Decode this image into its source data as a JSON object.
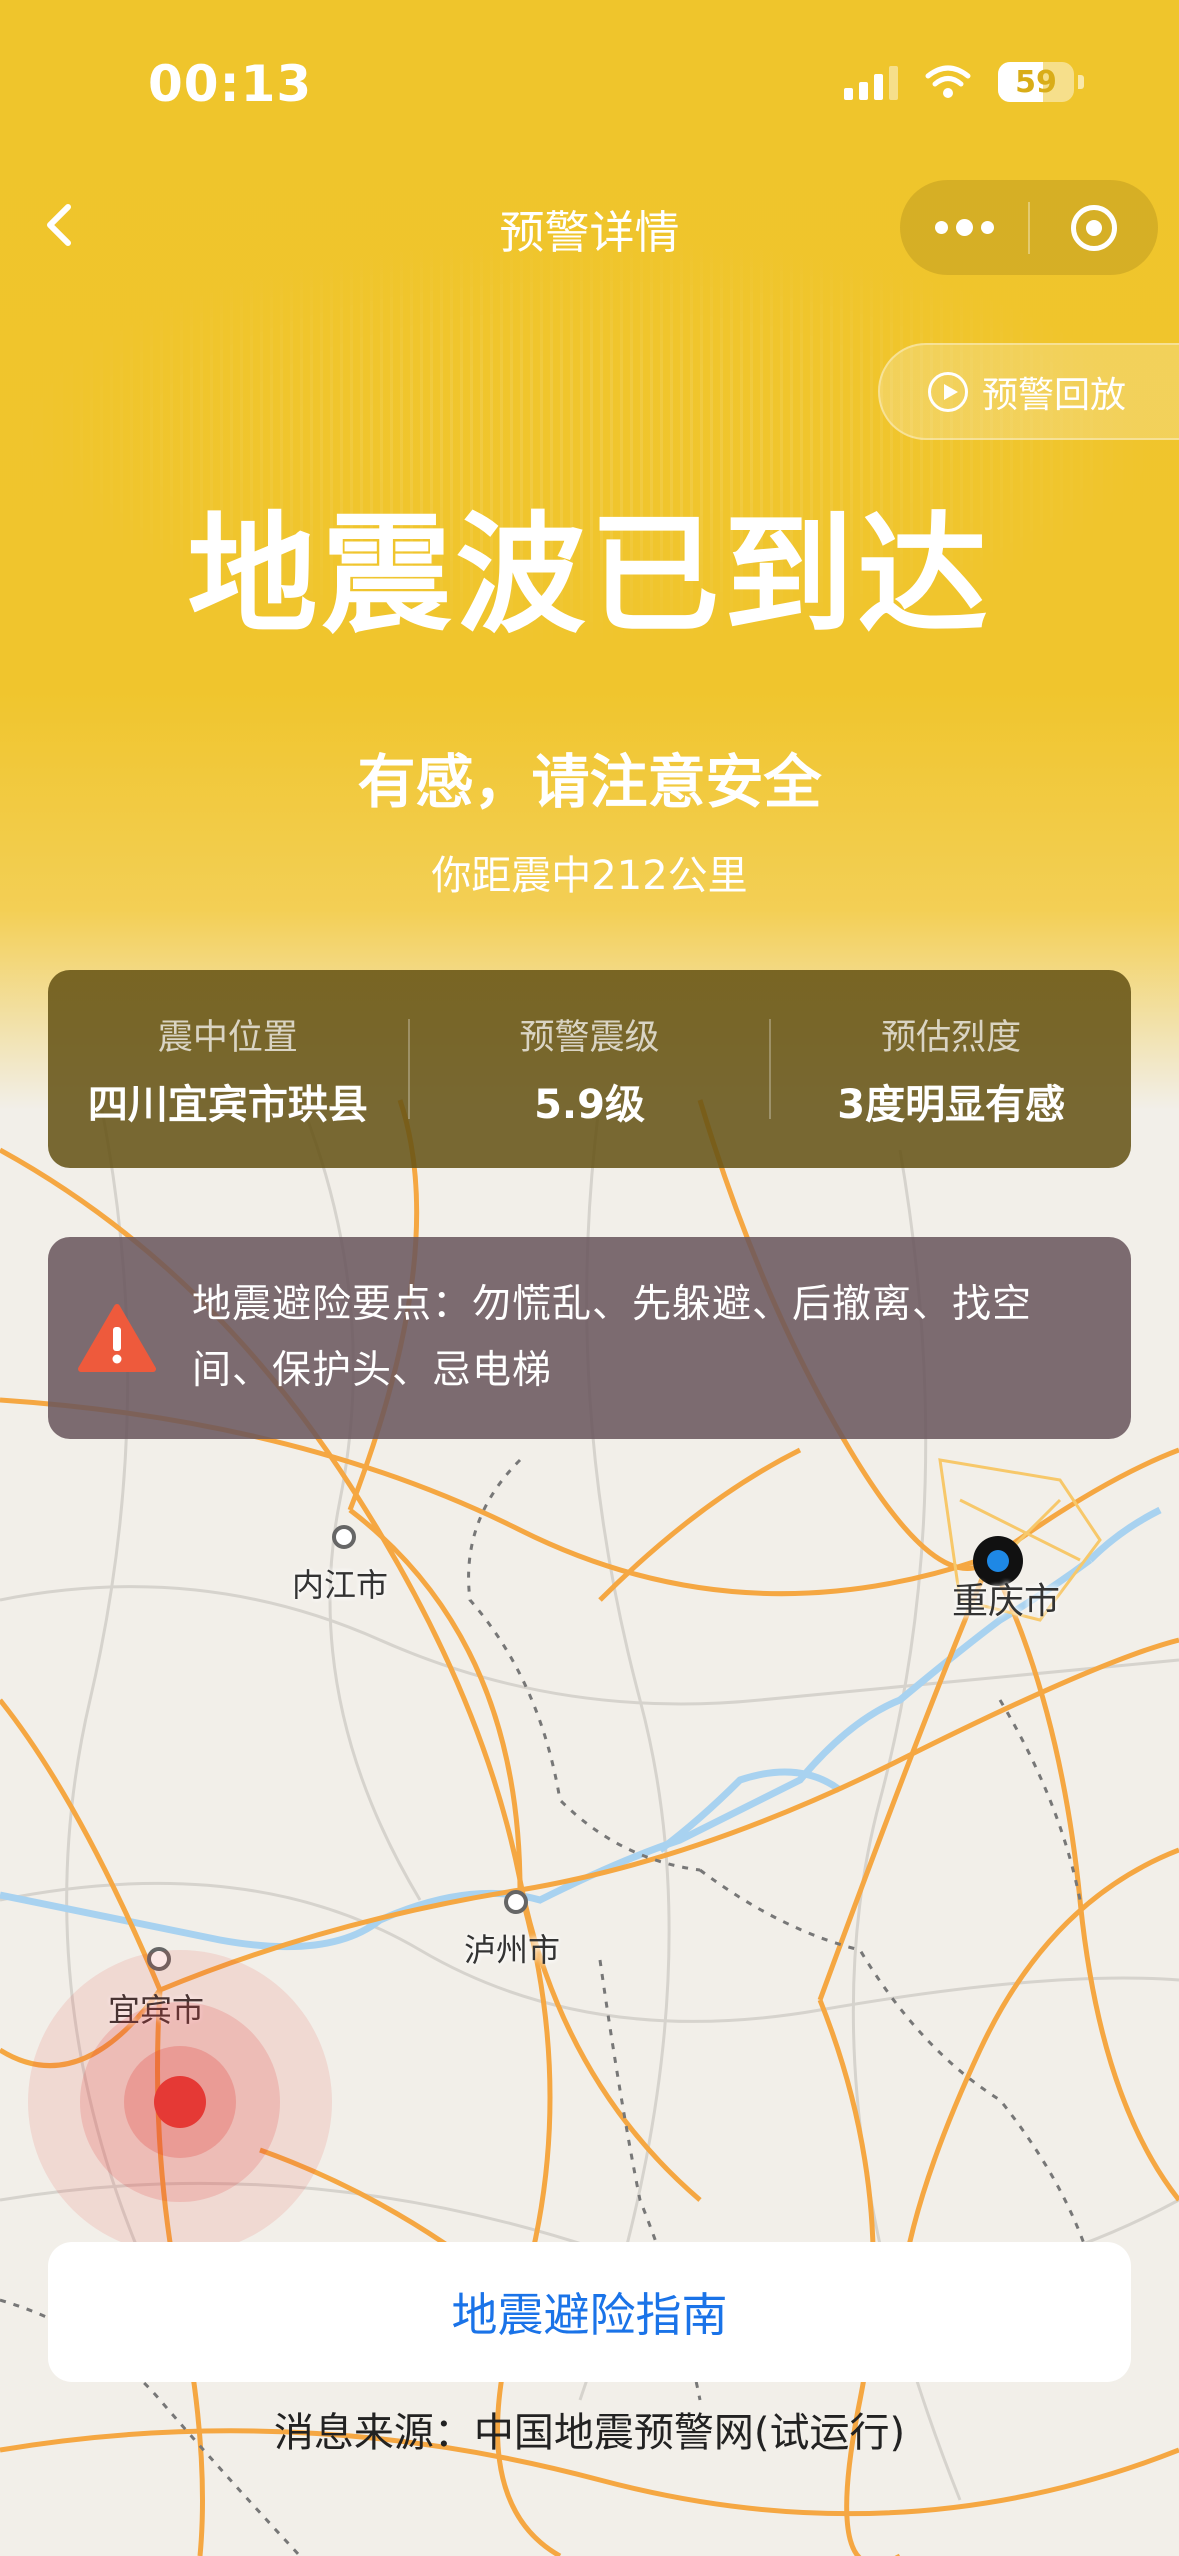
{
  "status_bar": {
    "time": "00:13",
    "battery": "59",
    "battery_level": 0.59
  },
  "nav": {
    "title": "预警详情"
  },
  "replay": {
    "label": "预警回放"
  },
  "hero": {
    "title": "地震波已到达",
    "subtitle": "有感，请注意安全",
    "distance": "你距震中212公里"
  },
  "info": {
    "epicenter_label": "震中位置",
    "epicenter_value": "四川宜宾市珙县",
    "magnitude_label": "预警震级",
    "magnitude_value": "5.9级",
    "intensity_label": "预估烈度",
    "intensity_value": "3度明显有感"
  },
  "tip": {
    "text": "地震避险要点：勿慌乱、先躲避、后撤离、找空间、保护头、忌电梯"
  },
  "map": {
    "cities": {
      "neijiang": "内江市",
      "chongqing": "重庆市",
      "luzhou": "泸州市",
      "yibin": "宜宾市"
    }
  },
  "guide": {
    "button": "地震避险指南"
  },
  "source": {
    "text": "消息来源：中国地震预警网(试运行)"
  },
  "colors": {
    "header": "#efc52c",
    "road": "#f5a742",
    "border": "#666666",
    "river": "#a8d2f0",
    "link": "#1a73e8",
    "quake": "#e53935"
  }
}
